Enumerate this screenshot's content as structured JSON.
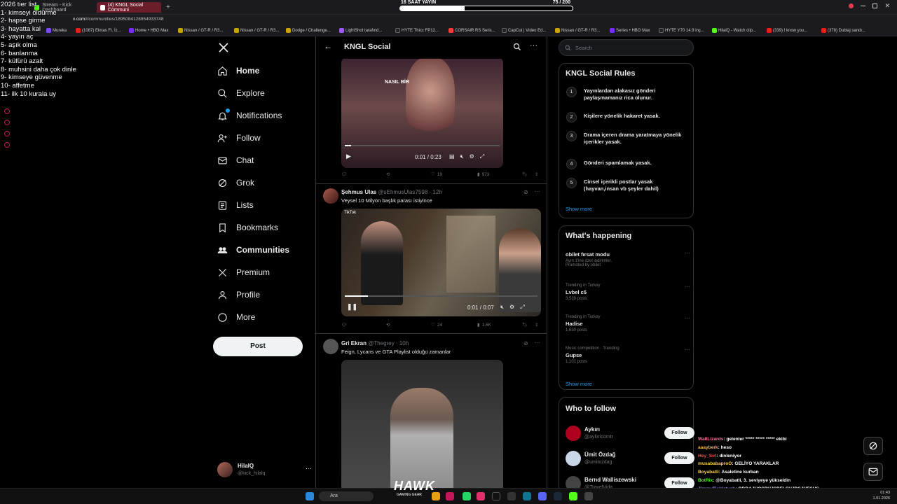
{
  "browser": {
    "tabs": [
      {
        "label": "Stream - Kick Dashboard"
      },
      {
        "label": "(4) KNGL Social Communi"
      }
    ],
    "url_prefix": "x.com",
    "url_path": "/i/communities/1895084128954933748",
    "bookmarks": [
      "Mureka",
      "(1087) Elmas Ft. İz...",
      "Home • HBO Max",
      "Nissan / GT-R / R3...",
      "Nissan / GT-R / R3...",
      "Dodge / Challenge...",
      "LightShot tarafınd...",
      "HYTE Thicc FP12...",
      "CORSAIR RS Seris...",
      "CapCut | Video Ed...",
      "Nissan / GT-R / R3...",
      "Series • HBO Max",
      "HYTE Y70 14.9 inç...",
      "HilalQ - Watch clip...",
      "(339) I know you...",
      "(378) Dublaj sandı..."
    ]
  },
  "overlay": {
    "progress_left": "16 SAAT YAYIN",
    "progress_right": "75 / 200",
    "progress_fraction": 0.375,
    "tierlist": [
      "2026 tier list",
      "1- kimseyi öldürme",
      "2- hapse girme",
      "3- hayatta kal",
      "4- yayın aç",
      "5- aşık olma",
      "6- banlanma",
      "7- küfürü azalt",
      "8- muhsini daha çok dinle",
      "9- kimseye güvenme",
      "10- affetme",
      "11- ilk 10 kurala uy"
    ]
  },
  "nav": {
    "items": [
      {
        "label": "Home",
        "icon": "home-icon"
      },
      {
        "label": "Explore",
        "icon": "search-icon"
      },
      {
        "label": "Notifications",
        "icon": "bell-icon"
      },
      {
        "label": "Follow",
        "icon": "add-person-icon"
      },
      {
        "label": "Chat",
        "icon": "mail-icon"
      },
      {
        "label": "Grok",
        "icon": "grok-icon"
      },
      {
        "label": "Lists",
        "icon": "list-icon"
      },
      {
        "label": "Bookmarks",
        "icon": "bookmark-icon"
      },
      {
        "label": "Communities",
        "icon": "communities-icon"
      },
      {
        "label": "Premium",
        "icon": "x-logo-icon"
      },
      {
        "label": "Profile",
        "icon": "profile-icon"
      },
      {
        "label": "More",
        "icon": "more-icon"
      }
    ],
    "post_label": "Post",
    "user_name": "HilalQ",
    "user_handle": "@kick_hilalq"
  },
  "feed": {
    "title": "KNGL Social",
    "video1": {
      "caption": "NASIL BİR",
      "time": "0:01 / 0:23",
      "likes": "19",
      "views": "973",
      "progress": 0.04
    },
    "tweet2": {
      "name": "Şehmus Ulas",
      "handle": "@sEhmusUlas7598",
      "time": "· 12h",
      "text": "Veysel 10 Milyon başlık parası istiyince",
      "video_time": "0:01 / 0:07",
      "watermark": "TikTok",
      "likes": "24",
      "views": "1.6K",
      "progress": 0.12
    },
    "tweet3": {
      "name": "Gri Ekran",
      "handle": "@Thegrey",
      "time": "· 10h",
      "text": "Feign, Lycans ve GTA Playlist olduğu zamanlar"
    }
  },
  "sidebar": {
    "search_placeholder": "Search",
    "rules_title": "KNGL Social Rules",
    "rules": [
      {
        "n": "1",
        "text": "Yayınlardan alakasız gönderi paylaşmamanız rica olunur."
      },
      {
        "n": "2",
        "text": "Kişilere yönelik hakaret yasak."
      },
      {
        "n": "3",
        "text": "Drama içeren drama yaratmaya yönelik içerikler yasak."
      },
      {
        "n": "4",
        "text": "Gönderi spamlamak yasak."
      },
      {
        "n": "5",
        "text": "Cinsel içerikli postlar yasak (hayvan,insan vb şeyler dahil)"
      }
    ],
    "show_more": "Show more",
    "happening_title": "What's happening",
    "trends": [
      {
        "cat": "",
        "name": "obilet fırsat modu",
        "sub": "Ayın 1'ine özel indirimler.",
        "count": "Promoted by obilet"
      },
      {
        "cat": "Trending in Turkey",
        "name": "Lvbel c5",
        "sub": "",
        "count": "3,539 posts"
      },
      {
        "cat": "Trending in Turkey",
        "name": "Hadise",
        "sub": "",
        "count": "1,630 posts"
      },
      {
        "cat": "Music competition · Trending",
        "name": "Gupse",
        "sub": "",
        "count": "1,101 posts"
      }
    ],
    "who_title": "Who to follow",
    "who": [
      {
        "name": "Aykırı",
        "handle": "@aykiricomtr"
      },
      {
        "name": "Ümit Özdağ",
        "handle": "@umitozdag"
      },
      {
        "name": "Bernd Walliszewski",
        "handle": "@TravelVida"
      }
    ],
    "follow_label": "Follow"
  },
  "chat": [
    {
      "user": "WallLizards",
      "color": "#ff6b9a",
      "msg": "gelenler ***** ***** ***** ekibi"
    },
    {
      "user": "aaayberk",
      "color": "#ffb347",
      "msg": "heso"
    },
    {
      "user": "Hey_Siri",
      "color": "#ff4d4d",
      "msg": "dinleniyor"
    },
    {
      "user": "musababaproO",
      "color": "#ffd24d",
      "msg": "GELİYO YARAKLAR"
    },
    {
      "user": "Boyabatli",
      "color": "#ffd24d",
      "msg": "Asaletine kurban"
    },
    {
      "user": "BotRix",
      "color": "#53fc18",
      "msg": "@Boyabatli, 3. seviyeye yükseldin"
    },
    {
      "user": "JimmyTickletush",
      "color": "#b48cff",
      "msg": "ODDAJHOSPHJSDFLŞHJDSJHFSHS"
    }
  ],
  "taskbar": {
    "search_label": "Ara",
    "clock_time": "01:43",
    "clock_date": "1.01.2026",
    "brand": "HAWK",
    "brand_sub": "GAMING GEAR"
  }
}
